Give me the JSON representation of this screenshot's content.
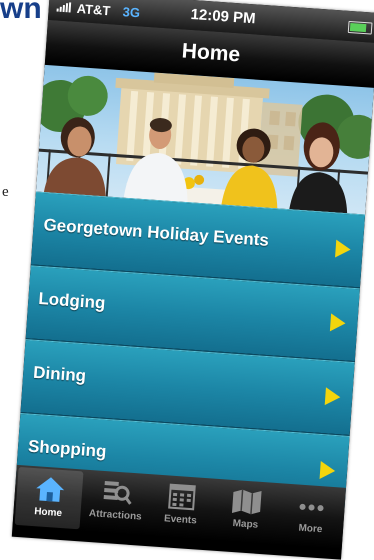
{
  "background": {
    "heading_fragment": "wn",
    "side_letter": "e"
  },
  "status_bar": {
    "carrier": "AT&T",
    "network": "3G",
    "time": "12:09 PM"
  },
  "nav": {
    "title": "Home"
  },
  "menu": {
    "items": [
      {
        "label": "Georgetown Holiday Events"
      },
      {
        "label": "Lodging"
      },
      {
        "label": "Dining"
      },
      {
        "label": "Shopping"
      }
    ]
  },
  "tabs": {
    "items": [
      {
        "label": "Home",
        "icon": "home-icon",
        "active": true
      },
      {
        "label": "Attractions",
        "icon": "attractions-icon",
        "active": false
      },
      {
        "label": "Events",
        "icon": "calendar-icon",
        "active": false
      },
      {
        "label": "Maps",
        "icon": "map-icon",
        "active": false
      },
      {
        "label": "More",
        "icon": "more-icon",
        "active": false
      }
    ]
  },
  "colors": {
    "menu_row": "#1c86a6",
    "chevron": "#f3d50d",
    "heading": "#173f8a",
    "active_tab_icon": "#5ab4ff"
  }
}
